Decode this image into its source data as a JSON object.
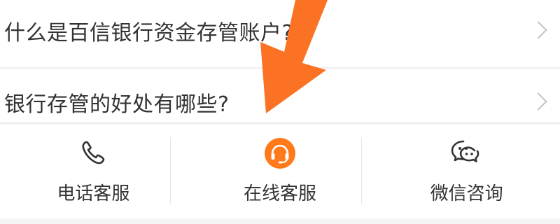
{
  "faq": {
    "items": [
      {
        "question": "什么是百信银行资金存管账户?"
      },
      {
        "question": "银行存管的好处有哪些?"
      }
    ]
  },
  "service_bar": {
    "items": [
      {
        "label": "电话客服",
        "icon": "phone-icon"
      },
      {
        "label": "在线客服",
        "icon": "headset-icon"
      },
      {
        "label": "微信咨询",
        "icon": "wechat-icon"
      }
    ]
  },
  "colors": {
    "accent_orange": "#ff7a1a",
    "arrow_orange": "#fb7224",
    "text": "#333333",
    "chevron": "#c2c2c2"
  }
}
